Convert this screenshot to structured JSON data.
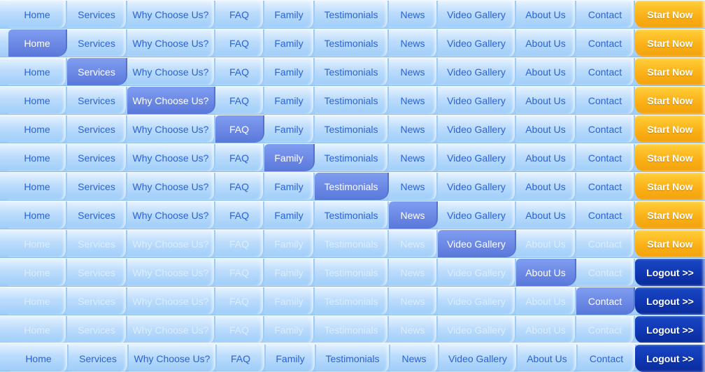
{
  "menu_labels": [
    "Home",
    "Services",
    "Why Choose Us?",
    "FAQ",
    "Family",
    "Testimonials",
    "News",
    "Video Gallery",
    "About Us",
    "Contact"
  ],
  "action_labels": {
    "start": "Start Now",
    "logout": "Logout >>"
  },
  "colors": {
    "bar_background": "#b9dcfb",
    "text": "#2a63d6",
    "faded_text": "#dbeeff",
    "active_tab": "#6b88e4",
    "start_button": "#fbb117",
    "logout_button": "#0f37b2"
  },
  "rows": [
    {
      "active": null,
      "action": "start",
      "faded": false
    },
    {
      "active": 0,
      "action": "start",
      "faded": false
    },
    {
      "active": 1,
      "action": "start",
      "faded": false
    },
    {
      "active": 2,
      "action": "start",
      "faded": false
    },
    {
      "active": 3,
      "action": "start",
      "faded": false
    },
    {
      "active": 4,
      "action": "start",
      "faded": false
    },
    {
      "active": 5,
      "action": "start",
      "faded": false
    },
    {
      "active": 6,
      "action": "start",
      "faded": false
    },
    {
      "active": 7,
      "action": "start",
      "faded": true
    },
    {
      "active": 8,
      "action": "logout",
      "faded": true
    },
    {
      "active": 9,
      "action": "logout",
      "faded": true
    },
    {
      "active": null,
      "action": "logout",
      "faded": true
    },
    {
      "active": null,
      "action": "logout",
      "faded": false
    }
  ]
}
